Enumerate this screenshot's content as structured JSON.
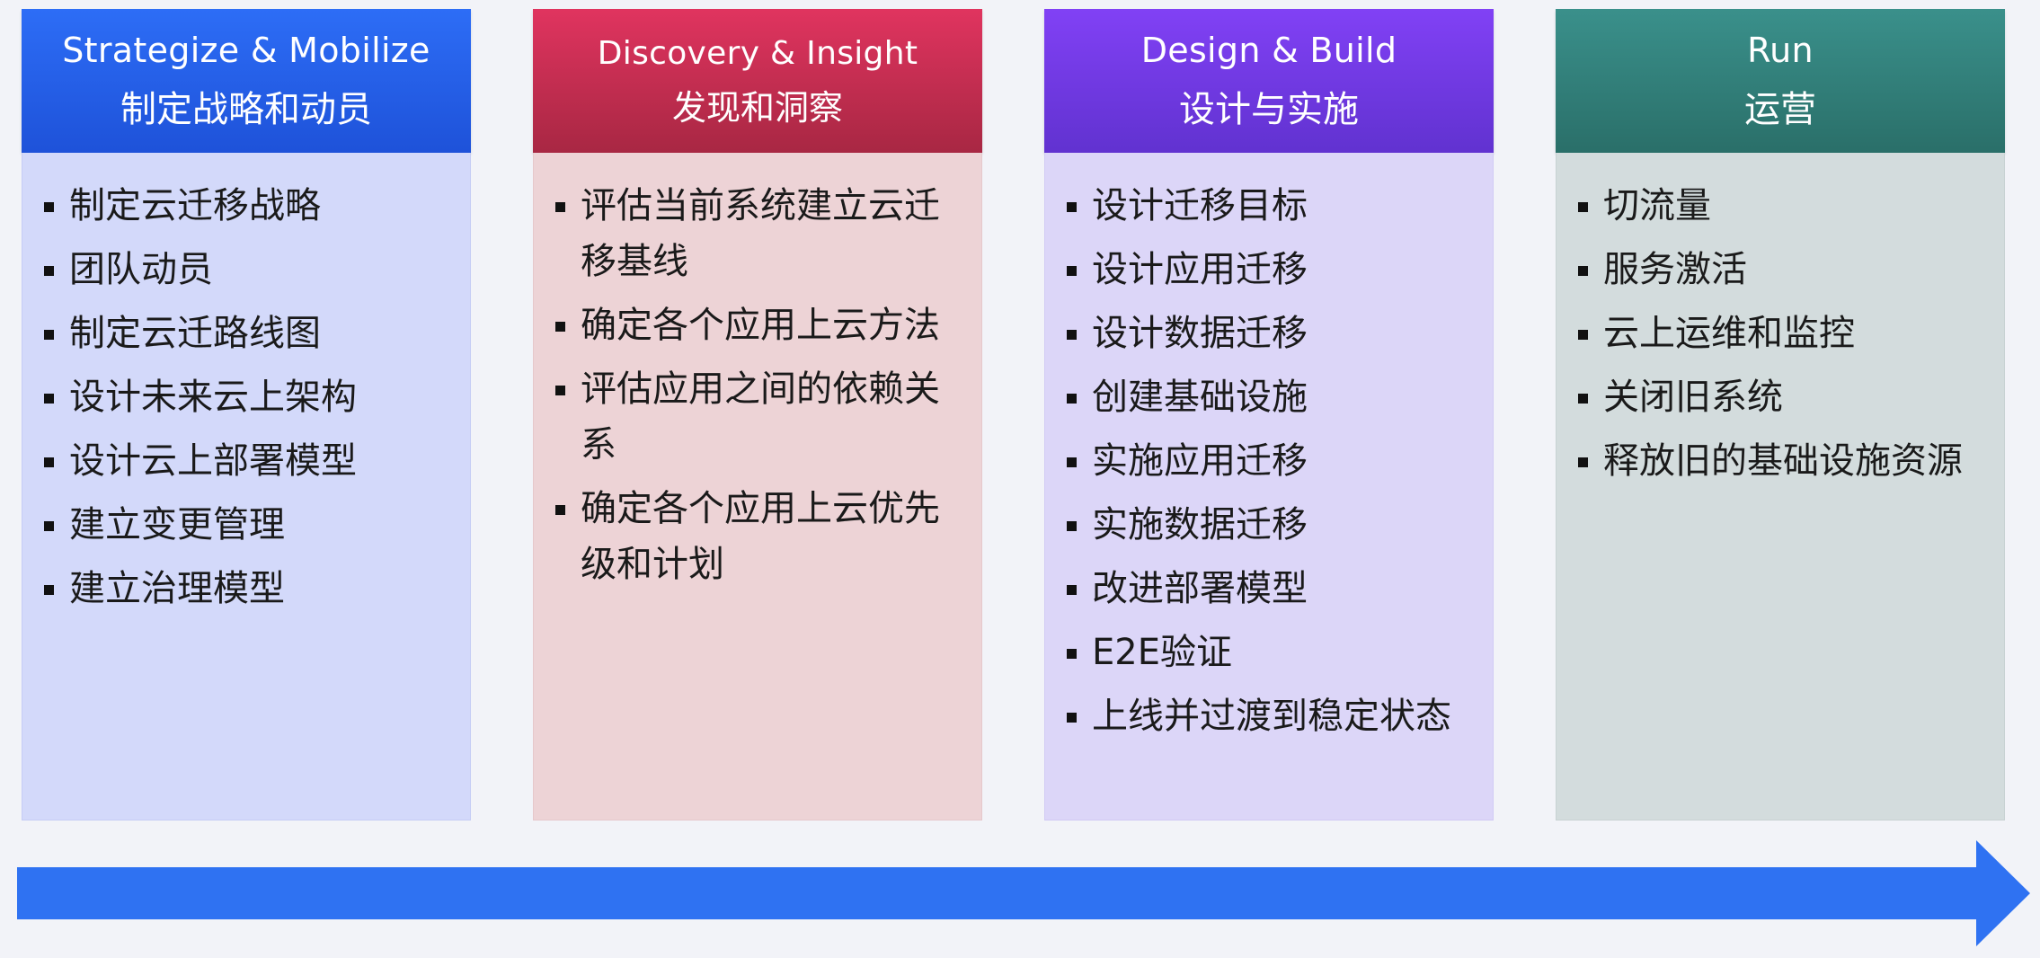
{
  "phases": [
    {
      "title_en": "Strategize & Mobilize",
      "title_zh": "制定战略和动员",
      "items": [
        "制定云迁移战略",
        "团队动员",
        "制定云迁路线图",
        "设计未来云上架构",
        "设计云上部署模型",
        "建立变更管理",
        "建立治理模型"
      ]
    },
    {
      "title_en": "Discovery & Insight",
      "title_zh": "发现和洞察",
      "items": [
        "评估当前系统建立云迁移基线",
        "确定各个应用上云方法",
        "评估应用之间的依赖关系",
        "确定各个应用上云优先级和计划"
      ]
    },
    {
      "title_en": "Design & Build",
      "title_zh": "设计与实施",
      "items": [
        "设计迁移目标",
        "设计应用迁移",
        "设计数据迁移",
        "创建基础设施",
        "实施应用迁移",
        "实施数据迁移",
        "改进部署模型",
        "E2E验证",
        "上线并过渡到稳定状态"
      ]
    },
    {
      "title_en": "Run",
      "title_zh": "运营",
      "items": [
        "切流量",
        "服务激活",
        "云上运维和监控",
        "关闭旧系统",
        "释放旧的基础设施资源"
      ]
    }
  ],
  "colors": {
    "background": "#f2f3f8",
    "arrow": "#2f72f2",
    "strategize": "#2d6df6",
    "discovery": "#e0345f",
    "design": "#8141f5",
    "run": "#3a908b"
  },
  "icons": {
    "arrow": "right-arrow",
    "bullet": "square-bullet"
  }
}
